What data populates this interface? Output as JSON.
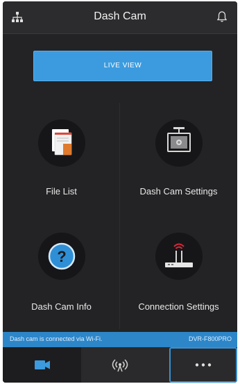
{
  "header": {
    "title": "Dash Cam"
  },
  "live_view": {
    "label": "LIVE VIEW"
  },
  "tiles": [
    {
      "label": "File List"
    },
    {
      "label": "Dash Cam Settings"
    },
    {
      "label": "Dash Cam Info"
    },
    {
      "label": "Connection Settings"
    }
  ],
  "status": {
    "message": "Dash cam is connected via Wi-Fi.",
    "model": "DVR-F800PRO"
  },
  "tabs": [
    {
      "icon": "video-camera-icon"
    },
    {
      "icon": "wifi-broadcast-icon"
    },
    {
      "icon": "more-icon"
    }
  ],
  "colors": {
    "background": "#232325",
    "accent": "#3c9bde",
    "status_bar": "#2d86c8",
    "file_icon": "#e07a2c",
    "router_signal": "#d9273a"
  }
}
